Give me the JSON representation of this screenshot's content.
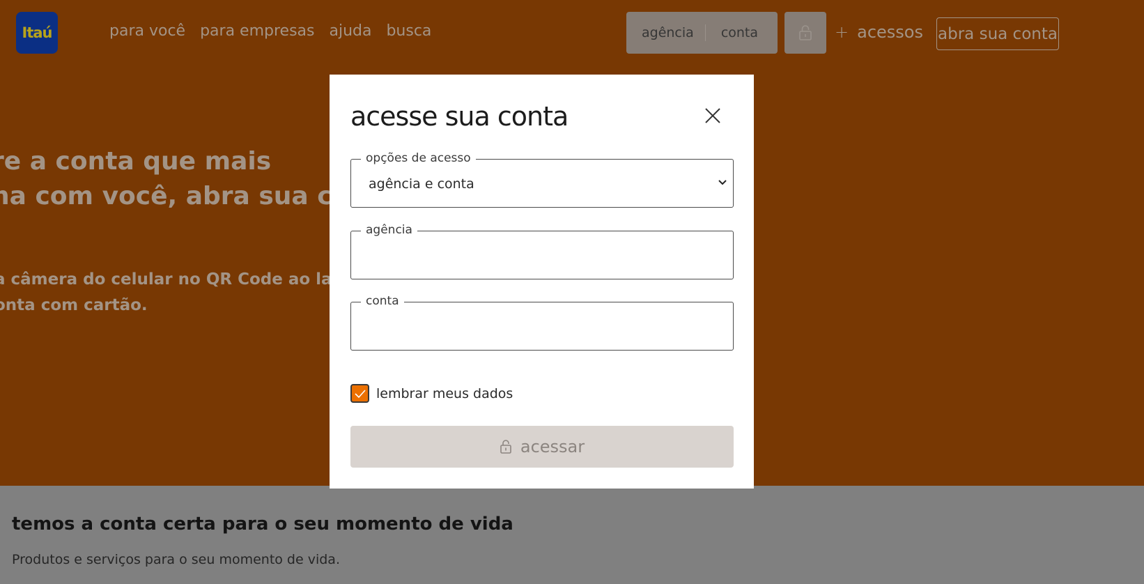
{
  "brand": {
    "logo_text": "Itaú",
    "logo_bg": "#0b2f84",
    "logo_fg": "#b8a31b",
    "accent": "#ec7000"
  },
  "header": {
    "nav": [
      "para você",
      "para empresas",
      "ajuda",
      "busca"
    ],
    "login_bar": {
      "agency_label": "agência",
      "account_label": "conta"
    },
    "lock_icon": "lock-icon",
    "more_access_label": "acessos",
    "open_account_label": "abra sua conta"
  },
  "hero": {
    "title_line1": "re a conta que mais",
    "title_line2": "na com você, abra sua conta",
    "text_line1": "a câmera do celular no QR Code ao lado e",
    "text_line2": "onta com cartão."
  },
  "section": {
    "title": "temos a conta certa para o seu momento de vida",
    "subtitle": "Produtos e serviços para o seu momento de vida."
  },
  "modal": {
    "title": "acesse sua conta",
    "close_icon": "close-icon",
    "access_options": {
      "label": "opções de acesso",
      "selected": "agência e conta"
    },
    "agency_field": {
      "label": "agência",
      "value": ""
    },
    "account_field": {
      "label": "conta",
      "value": ""
    },
    "remember": {
      "label": "lembrar meus dados",
      "checked": true
    },
    "submit_label": "acessar"
  }
}
